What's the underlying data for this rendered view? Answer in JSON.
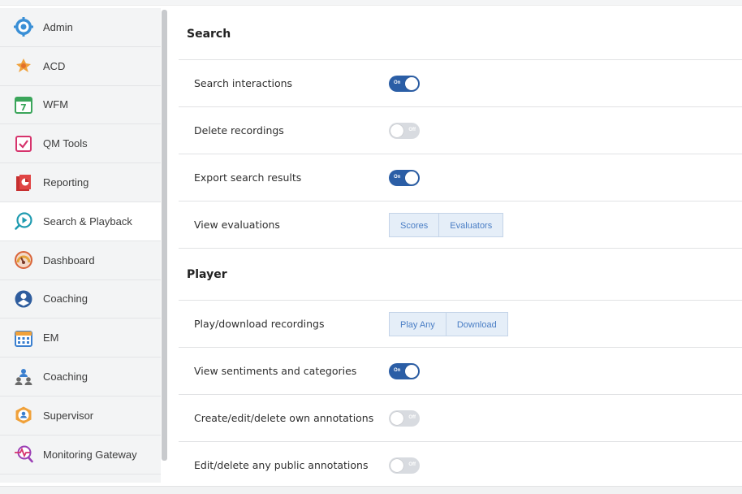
{
  "sidebar": {
    "items": [
      {
        "label": "Admin",
        "icon": "gear-icon"
      },
      {
        "label": "ACD",
        "icon": "acd-icon"
      },
      {
        "label": "WFM",
        "icon": "calendar-icon"
      },
      {
        "label": "QM Tools",
        "icon": "checkbox-icon"
      },
      {
        "label": "Reporting",
        "icon": "reporting-icon"
      },
      {
        "label": "Search & Playback",
        "icon": "search-playback-icon"
      },
      {
        "label": "Dashboard",
        "icon": "gauge-icon"
      },
      {
        "label": "Coaching",
        "icon": "coaching-icon"
      },
      {
        "label": "EM",
        "icon": "calendar-grid-icon"
      },
      {
        "label": "Coaching",
        "icon": "people-icon"
      },
      {
        "label": "Supervisor",
        "icon": "supervisor-icon"
      },
      {
        "label": "Monitoring Gateway",
        "icon": "monitor-search-icon"
      }
    ],
    "active_index": 5
  },
  "search": {
    "title": "Search",
    "search_interactions": {
      "label": "Search interactions",
      "toggle": "On"
    },
    "delete_recordings": {
      "label": "Delete recordings",
      "toggle": "Off"
    },
    "export_search_results": {
      "label": "Export search results",
      "toggle": "On"
    },
    "view_evaluations": {
      "label": "View evaluations",
      "options": [
        "Scores",
        "Evaluators"
      ]
    }
  },
  "player": {
    "title": "Player",
    "play_download": {
      "label": "Play/download recordings",
      "options": [
        "Play Any",
        "Download"
      ]
    },
    "view_sentiments": {
      "label": "View sentiments and categories",
      "toggle": "On"
    },
    "own_annotations": {
      "label": "Create/edit/delete own annotations",
      "toggle": "Off"
    },
    "public_annotations": {
      "label": "Edit/delete any public annotations",
      "toggle": "Off"
    }
  },
  "colors": {
    "toggle_on": "#2b5ea6",
    "toggle_off": "#d8dbe0",
    "segment_text": "#4a7ec5",
    "segment_bg": "#e5eef8"
  }
}
